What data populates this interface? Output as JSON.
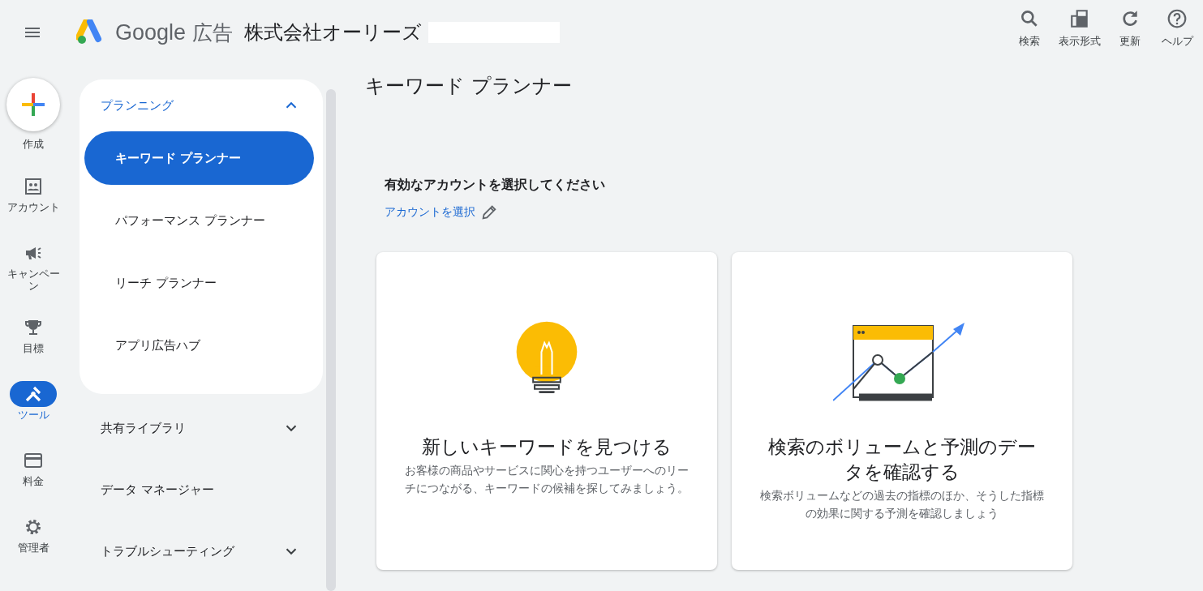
{
  "header": {
    "brand": "Google",
    "product": "広告",
    "account_name": "株式会社オーリーズ",
    "actions": [
      {
        "kind": "search",
        "label": "検索"
      },
      {
        "kind": "view",
        "label": "表示形式"
      },
      {
        "kind": "refresh",
        "label": "更新"
      },
      {
        "kind": "help",
        "label": "ヘルプ"
      }
    ]
  },
  "create": {
    "label": "作成"
  },
  "rail": [
    {
      "kind": "account",
      "label": "アカウント",
      "selected": false
    },
    {
      "kind": "campaign",
      "label": "キャンペーン",
      "selected": false
    },
    {
      "kind": "goal",
      "label": "目標",
      "selected": false
    },
    {
      "kind": "tools",
      "label": "ツール",
      "selected": true
    },
    {
      "kind": "billing",
      "label": "料金",
      "selected": false
    },
    {
      "kind": "admin",
      "label": "管理者",
      "selected": false
    }
  ],
  "nav": [
    {
      "label": "プランニング",
      "expanded": true,
      "children": [
        {
          "label": "キーワード プランナー",
          "selected": true
        },
        {
          "label": "パフォーマンス プランナー",
          "selected": false
        },
        {
          "label": "リーチ プランナー",
          "selected": false
        },
        {
          "label": "アプリ広告ハブ",
          "selected": false
        }
      ]
    },
    {
      "label": "共有ライブラリ",
      "expanded": false
    },
    {
      "label": "データ マネージャー"
    },
    {
      "label": "トラブルシューティング",
      "expanded": false
    }
  ],
  "main": {
    "title": "キーワード プランナー",
    "prompt": "有効なアカウントを選択してください",
    "select_link": "アカウントを選択",
    "cards": [
      {
        "kind": "bulb",
        "title": "新しいキーワードを見つける",
        "description": "お客様の商品やサービスに関心を持つユーザーへのリーチにつながる、キーワードの候補を探してみましょう。"
      },
      {
        "kind": "chart",
        "title": "検索のボリュームと予測のデータを確認する",
        "description": "検索ボリュームなどの過去の指標のほか、そうした指標の効果に関する予測を確認しましょう"
      }
    ]
  }
}
